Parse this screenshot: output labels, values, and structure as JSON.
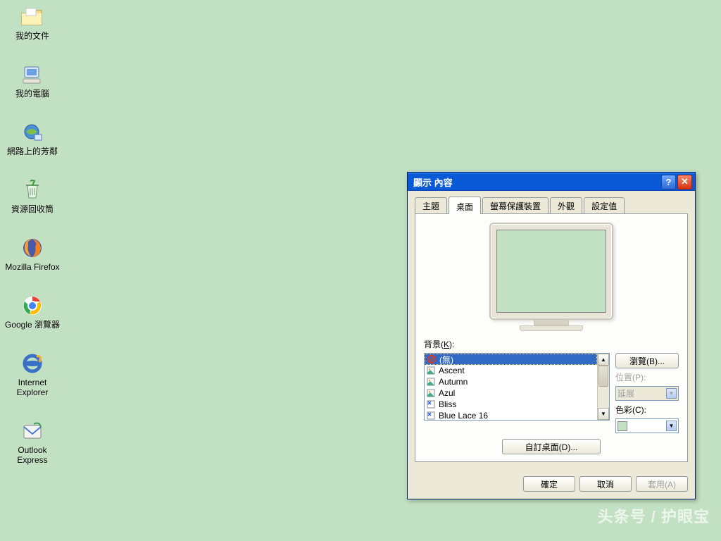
{
  "desktop": {
    "icons": [
      {
        "id": "my-documents",
        "label": "我的文件"
      },
      {
        "id": "my-computer",
        "label": "我的電腦"
      },
      {
        "id": "network",
        "label": "網路上的芳鄰"
      },
      {
        "id": "recycle-bin",
        "label": "資源回收筒"
      },
      {
        "id": "firefox",
        "label": "Mozilla Firefox"
      },
      {
        "id": "chrome",
        "label": "Google 瀏覽器"
      },
      {
        "id": "ie",
        "label": "Internet\nExplorer"
      },
      {
        "id": "outlook",
        "label": "Outlook\nExpress"
      }
    ]
  },
  "dialog": {
    "title": "顯示 內容",
    "tabs": [
      "主題",
      "桌面",
      "螢幕保護裝置",
      "外觀",
      "設定值"
    ],
    "active_tab": 1,
    "bg_label_prefix": "背景(",
    "bg_label_key": "K",
    "bg_label_suffix": "):",
    "bg_items": [
      {
        "name": "(無)",
        "icon": "none",
        "selected": true
      },
      {
        "name": "Ascent",
        "icon": "img"
      },
      {
        "name": "Autumn",
        "icon": "img"
      },
      {
        "name": "Azul",
        "icon": "img"
      },
      {
        "name": "Bliss",
        "icon": "bmp"
      },
      {
        "name": "Blue Lace 16",
        "icon": "bmp"
      }
    ],
    "browse_btn": "瀏覽(B)...",
    "position_lbl": "位置(P):",
    "position_val": "延展",
    "color_lbl": "色彩(C):",
    "custom_btn": "自訂桌面(D)...",
    "ok": "確定",
    "cancel": "取消",
    "apply": "套用(A)"
  },
  "watermark": "头条号 / 护眼宝"
}
